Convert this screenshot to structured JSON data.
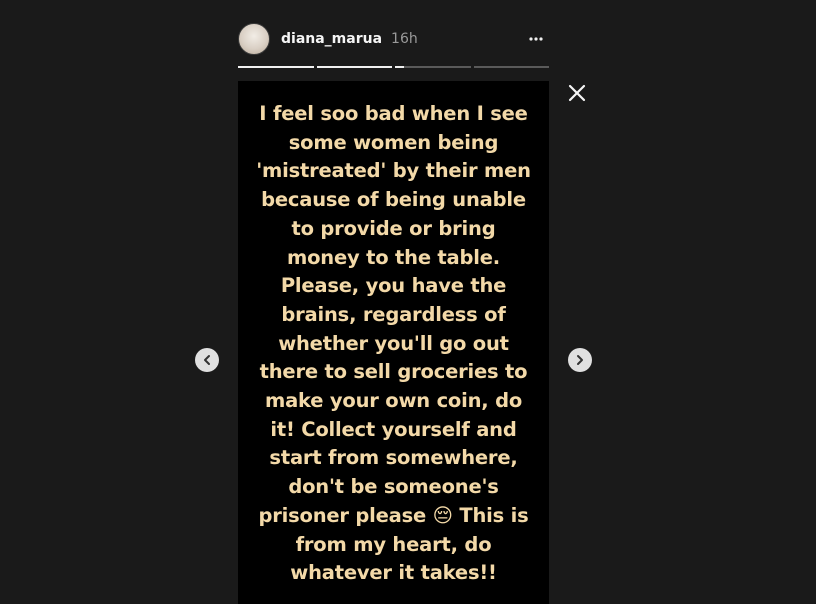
{
  "header": {
    "username": "diana_marua",
    "timestamp": "16h",
    "more_icon": "more-horizontal-icon"
  },
  "progress": {
    "segments": [
      1,
      1,
      0.12,
      0
    ]
  },
  "story": {
    "text": "I feel soo bad when I see\nsome women being\n'mistreated' by their men\nbecause of being unable\nto provide or bring\nmoney to the table.\nPlease, you have the\nbrains, regardless of\nwhether you'll go out\nthere to sell groceries to\nmake your own coin, do\nit! Collect yourself and\nstart from somewhere,\ndon't be someone's\nprisoner please 😔  This is\nfrom my heart, do\nwhatever it takes!!",
    "text_color": "#f3d9a8",
    "background": "#000000"
  },
  "controls": {
    "close_icon": "close-icon",
    "prev_icon": "chevron-left-icon",
    "next_icon": "chevron-right-icon"
  },
  "colors": {
    "page_background": "#1a1a1a",
    "progress_active": "#f0f0f0",
    "progress_inactive": "#5a5a5a"
  }
}
